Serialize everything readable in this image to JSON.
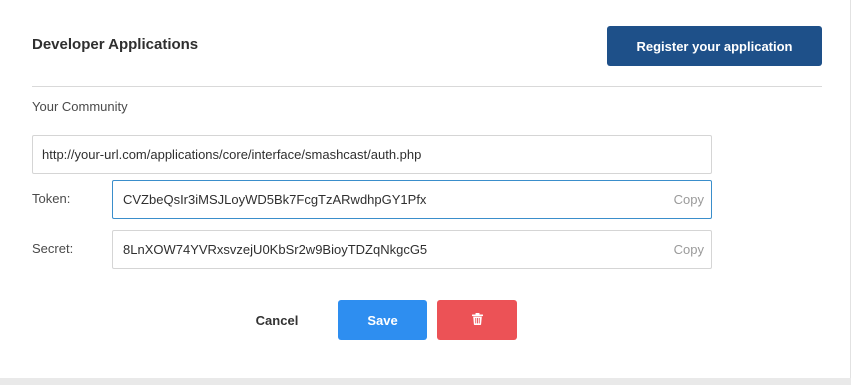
{
  "header": {
    "title": "Developer Applications",
    "register_label": "Register your application"
  },
  "community": {
    "label": "Your Community",
    "url": "http://your-url.com/applications/core/interface/smashcast/auth.php"
  },
  "token": {
    "label": "Token:",
    "value": "CVZbeQsIr3iMSJLoyWD5Bk7FcgTzARwdhpGY1Pfx",
    "copy_label": "Copy"
  },
  "secret": {
    "label": "Secret:",
    "value": "8LnXOW74YVRxsvzejU0KbSr2w9BioyTDZqNkgcG5",
    "copy_label": "Copy"
  },
  "actions": {
    "cancel_label": "Cancel",
    "save_label": "Save",
    "delete_icon": "trash-icon"
  },
  "colors": {
    "primary_dark": "#1e5089",
    "primary": "#2e8ef0",
    "danger": "#ec5256",
    "focus_border": "#3a8ecb"
  }
}
